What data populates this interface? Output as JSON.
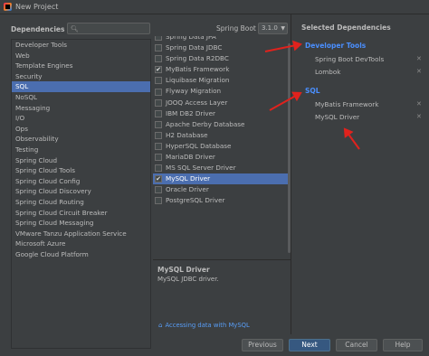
{
  "window": {
    "title": "New Project"
  },
  "left": {
    "dependencies_label": "Dependencies",
    "search": {
      "value": "",
      "placeholder": ""
    },
    "categories": [
      "Developer Tools",
      "Web",
      "Template Engines",
      "Security",
      "SQL",
      "NoSQL",
      "Messaging",
      "I/O",
      "Ops",
      "Observability",
      "Testing",
      "Spring Cloud",
      "Spring Cloud Tools",
      "Spring Cloud Config",
      "Spring Cloud Discovery",
      "Spring Cloud Routing",
      "Spring Cloud Circuit Breaker",
      "Spring Cloud Messaging",
      "VMware Tanzu Application Service",
      "Microsoft Azure",
      "Google Cloud Platform"
    ],
    "selected_category": "SQL"
  },
  "middle": {
    "spring_boot_label": "Spring Boot",
    "spring_boot_version": "3.1.0",
    "dependencies": [
      {
        "label": "Spring Data JPA",
        "checked": false
      },
      {
        "label": "Spring Data JDBC",
        "checked": false
      },
      {
        "label": "Spring Data R2DBC",
        "checked": false
      },
      {
        "label": "MyBatis Framework",
        "checked": true
      },
      {
        "label": "Liquibase Migration",
        "checked": false
      },
      {
        "label": "Flyway Migration",
        "checked": false
      },
      {
        "label": "JOOQ Access Layer",
        "checked": false
      },
      {
        "label": "IBM DB2 Driver",
        "checked": false
      },
      {
        "label": "Apache Derby Database",
        "checked": false
      },
      {
        "label": "H2 Database",
        "checked": false
      },
      {
        "label": "HyperSQL Database",
        "checked": false
      },
      {
        "label": "MariaDB Driver",
        "checked": false
      },
      {
        "label": "MS SQL Server Driver",
        "checked": false
      },
      {
        "label": "MySQL Driver",
        "checked": true
      },
      {
        "label": "Oracle Driver",
        "checked": false
      },
      {
        "label": "PostgreSQL Driver",
        "checked": false
      }
    ],
    "selected_dependency": "MySQL Driver",
    "description": {
      "title": "MySQL Driver",
      "text": "MySQL JDBC driver."
    },
    "guide_link": "Accessing data with MySQL"
  },
  "right": {
    "title": "Selected Dependencies",
    "groups": [
      {
        "name": "Developer Tools",
        "items": [
          "Spring Boot DevTools",
          "Lombok"
        ]
      },
      {
        "name": "SQL",
        "items": [
          "MyBatis Framework",
          "MySQL Driver"
        ]
      }
    ]
  },
  "buttons": {
    "previous": "Previous",
    "next": "Next",
    "cancel": "Cancel",
    "help": "Help"
  },
  "colors": {
    "accent": "#4b6eaf",
    "annotation": "#e0221d",
    "link": "#589df6",
    "group_highlight": "#1f6fe0"
  }
}
